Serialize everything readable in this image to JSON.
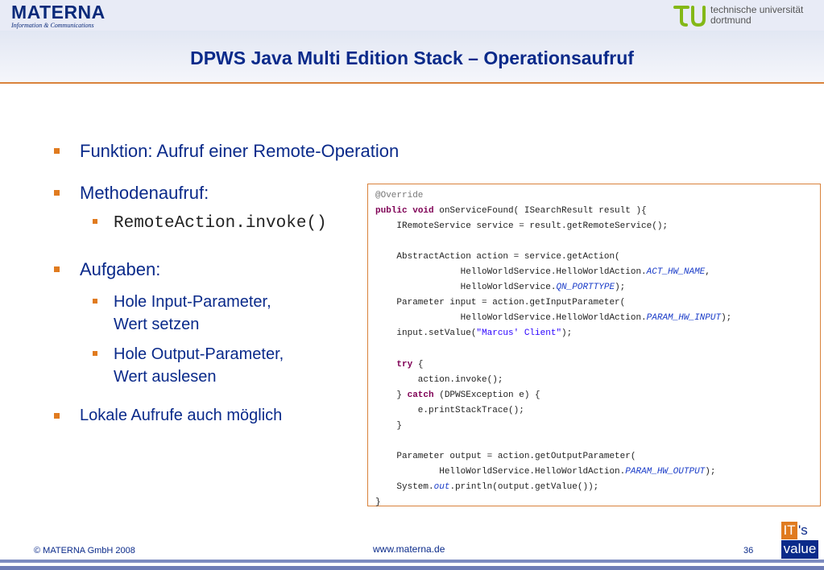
{
  "header": {
    "materna_logo": "MATERNA",
    "materna_sub": "Information & Communications",
    "tu_line1": "technische universität",
    "tu_line2": "dortmund"
  },
  "title": "DPWS Java Multi Edition Stack – Operationsaufruf",
  "bullets": {
    "b1": "Funktion: Aufruf einer Remote-Operation",
    "b2": "Methodenaufruf:",
    "b2_sub1": "RemoteAction.invoke()",
    "b3": "Aufgaben:",
    "b3_sub1_l1": "Hole Input-Parameter,",
    "b3_sub1_l2": "Wert setzen",
    "b3_sub2_l1": "Hole Output-Parameter,",
    "b3_sub2_l2": "Wert auslesen",
    "b4": "Lokale Aufrufe auch möglich"
  },
  "code": {
    "annotation": "@Override",
    "kw_public": "public",
    "kw_void": "void",
    "sig_rest": " onServiceFound( ISearchResult result ){",
    "line3": "    IRemoteService service = result.getRemoteService();",
    "line5": "    AbstractAction action = service.getAction(",
    "line6_pre": "                HelloWorldService.HelloWorldAction.",
    "line6_const": "ACT_HW_NAME",
    "line6_post": ",",
    "line7_pre": "                HelloWorldService.",
    "line7_const": "QN_PORTTYPE",
    "line7_post": ");",
    "line8": "    Parameter input = action.getInputParameter(",
    "line9_pre": "                HelloWorldService.HelloWorldAction.",
    "line9_const": "PARAM_HW_INPUT",
    "line9_post": ");",
    "line10_pre": "    input.setValue(",
    "line10_str": "\"Marcus' Client\"",
    "line10_post": ");",
    "line12_indent": "    ",
    "kw_try": "try",
    "line12_post": " {",
    "line13": "        action.invoke();",
    "line14_pre": "    } ",
    "kw_catch": "catch",
    "line14_post": " (DPWSException e) {",
    "line15": "        e.printStackTrace();",
    "line16": "    }",
    "line18": "    Parameter output = action.getOutputParameter(",
    "line19_pre": "            HelloWorldService.HelloWorldAction.",
    "line19_const": "PARAM_HW_OUTPUT",
    "line19_post": ");",
    "line20_pre": "    System.",
    "line20_const": "out",
    "line20_post": ".println(output.getValue());",
    "line21": "}"
  },
  "footer": {
    "copyright": "© MATERNA GmbH 2008",
    "url": "www.materna.de",
    "page": "36",
    "badge_it": "IT",
    "badge_s": "'s",
    "badge_value": "value"
  },
  "colors": {
    "title_blue": "#0a2a8a",
    "accent_orange": "#e07b1f",
    "tu_green": "#84b817"
  }
}
